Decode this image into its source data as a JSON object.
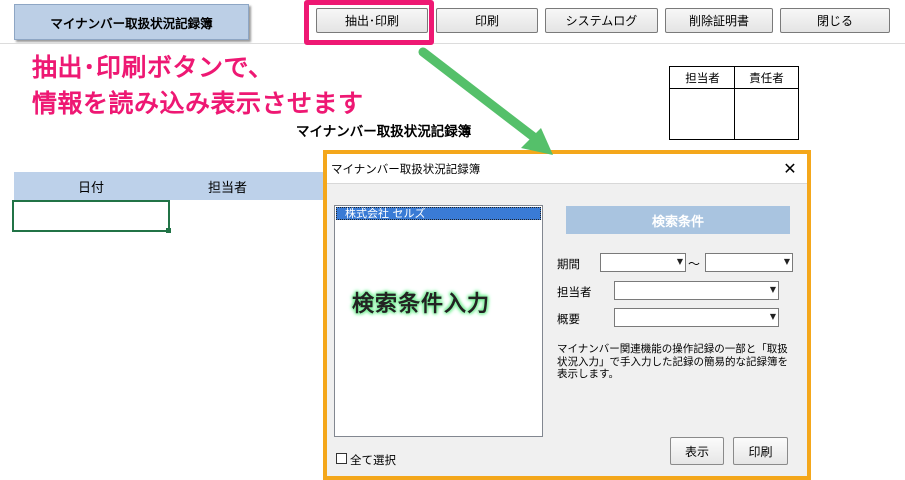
{
  "app": {
    "sheet_title_plate": "マイナンバー取扱状況記録簿",
    "toolbar": {
      "extract_print": "抽出･印刷",
      "print": "印刷",
      "system_log": "システムログ",
      "deletion_certificate": "削除証明書",
      "close": "閉じる"
    }
  },
  "callout": {
    "line1": "抽出･印刷ボタンで、",
    "line2": "情報を読み込み表示させます",
    "color": "#ee1873"
  },
  "stamp": {
    "person_in_charge": "担当者",
    "supervisor": "責任者"
  },
  "sheet": {
    "title": "マイナンバー取扱状況記録簿",
    "columns": [
      "日付",
      "担当者"
    ]
  },
  "dialog": {
    "title": "マイナンバー取扱状況記録簿",
    "close_glyph": "✕",
    "companies": [
      "株式会社 セルズ"
    ],
    "list_overlay": "検索条件入力",
    "select_all": "全て選択",
    "search_heading": "検索条件",
    "period_label": "期間",
    "period_separator": "～",
    "staff_label": "担当者",
    "summary_label": "概要",
    "description": "マイナンバー関連機能の操作記録の一部と「取扱状況入力」で手入力した記録の簡易的な記録簿を表示します。",
    "show_button": "表示",
    "print_button": "印刷",
    "frame_color": "#f4a71b"
  }
}
